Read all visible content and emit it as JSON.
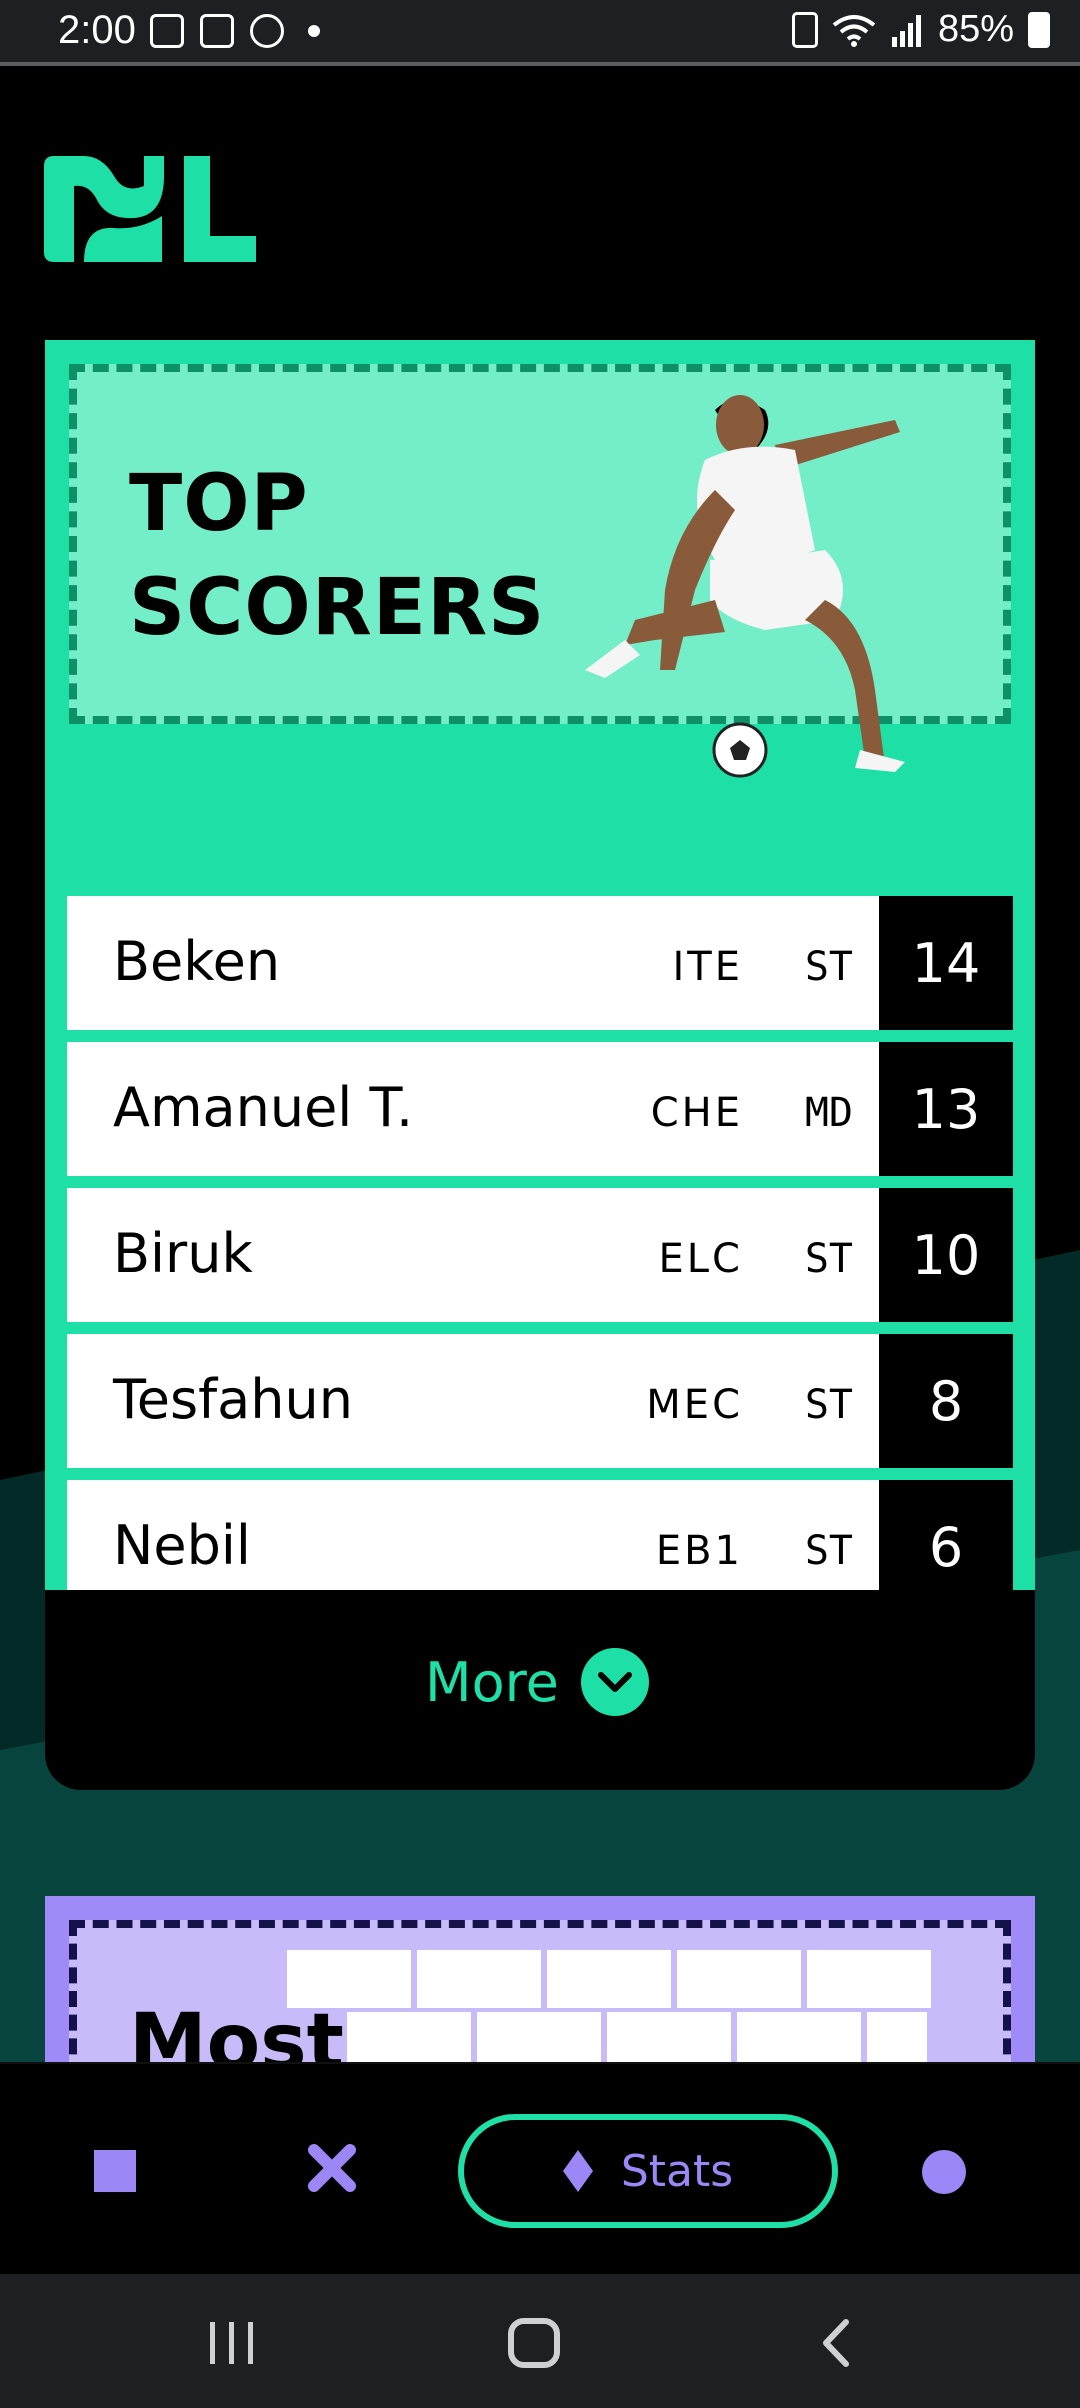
{
  "status_bar": {
    "time": "2:00",
    "battery_percent": "85%"
  },
  "app": {
    "logo_icon": "league-logo",
    "accent_color": "#1ee0a6",
    "secondary_color": "#9b87f5"
  },
  "top_scorers": {
    "title_line1": "TOP",
    "title_line2": "SCORERS",
    "rows": [
      {
        "name": "Beken",
        "team": "ITE",
        "position": "ST",
        "goals": "14"
      },
      {
        "name": "Amanuel T.",
        "team": "CHE",
        "position": "MD",
        "goals": "13"
      },
      {
        "name": "Biruk",
        "team": "ELC",
        "position": "ST",
        "goals": "10"
      },
      {
        "name": "Tesfahun",
        "team": "MEC",
        "position": "ST",
        "goals": "8"
      },
      {
        "name": "Nebil",
        "team": "EB1",
        "position": "ST",
        "goals": "6"
      }
    ],
    "more_label": "More"
  },
  "next_section": {
    "title": "Most"
  },
  "bottom_nav": {
    "stats_label": "Stats",
    "items": [
      "square-icon",
      "x-icon",
      "diamond-icon",
      "circle-icon"
    ]
  }
}
